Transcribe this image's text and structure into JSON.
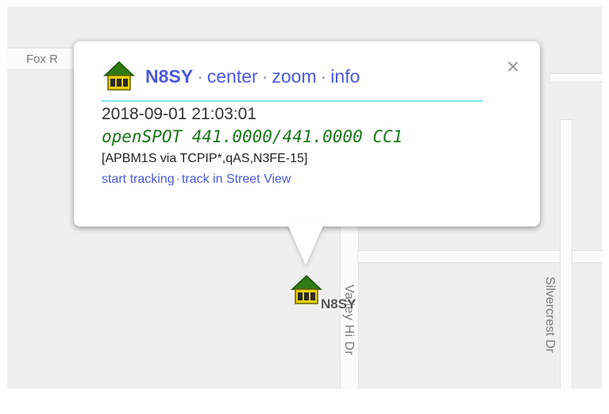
{
  "map": {
    "roads": {
      "fox": "Fox R",
      "valley": "Valley Hi Dr",
      "silvercrest": "Silvercrest Dr"
    },
    "marker": {
      "callsign": "N8SY",
      "icon": "house-icon"
    }
  },
  "popup": {
    "icon": "house-icon",
    "callsign": "N8SY",
    "links": {
      "center": "center",
      "zoom": "zoom",
      "info": "info"
    },
    "separator": "·",
    "close_icon": "close-icon",
    "timestamp": "2018-09-01 21:03:01",
    "status": "openSPOT 441.0000/441.0000 CC1",
    "path": "[APBM1S via TCPIP*,qAS,N3FE-15]",
    "actions": {
      "start_tracking": "start tracking",
      "street_view": "track in Street View"
    }
  },
  "colors": {
    "callsign": "#1b27d9",
    "link": "#4b58dc",
    "status": "#197519",
    "header_underline": "#7de7ee",
    "house_roof": "#2f7a14",
    "house_body": "#e7d200"
  }
}
